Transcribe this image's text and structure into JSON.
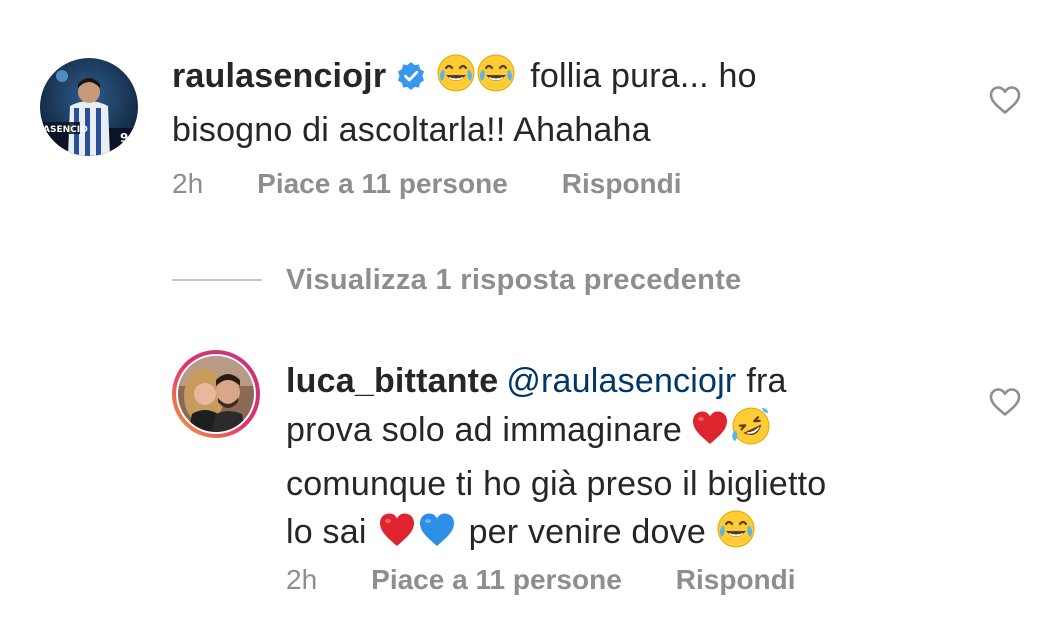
{
  "comments": [
    {
      "username": "raulasenciojr",
      "verified": true,
      "text_part1": "follia pura... ho",
      "text_line2": "bisogno di ascoltarla!! Ahahaha",
      "time": "2h",
      "likes": "Piace a 11 persone",
      "reply": "Rispondi",
      "avatar_jersey_name": "ASENCIO",
      "avatar_jersey_number": "9"
    },
    {
      "username": "luca_bittante",
      "mention": "@raulasenciojr",
      "text_line1_end": "fra",
      "text_line2": "prova solo ad immaginare",
      "text_line3": "comunque ti ho già preso il biglietto",
      "text_line4_a": "lo sai",
      "text_line4_b": "per venire dove",
      "time": "2h",
      "likes": "Piace a 11 persone",
      "reply": "Rispondi"
    }
  ],
  "view_replies": {
    "label": "Visualizza 1 risposta precedente"
  },
  "icons": {
    "like": "heart-outline-icon",
    "verified": "verified-badge-icon",
    "emoji_laugh": "face-with-tears-of-joy-emoji",
    "emoji_rofl": "rolling-on-the-floor-laughing-emoji",
    "emoji_red_heart": "red-heart-emoji",
    "emoji_blue_heart": "blue-heart-emoji"
  },
  "colors": {
    "text": "#262626",
    "secondary": "#8e8e8e",
    "mention": "#00376b",
    "verified": "#3897f0"
  }
}
